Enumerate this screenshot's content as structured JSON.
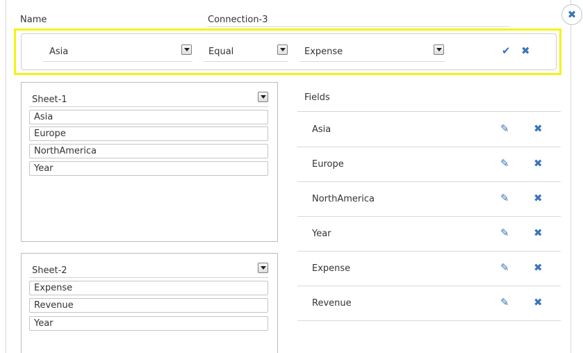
{
  "header": {
    "name_label": "Name",
    "connection_name": "Connection-3"
  },
  "condition": {
    "field": "Asia",
    "operator": "Equal",
    "value": "Expense"
  },
  "sheets": [
    {
      "title": "Sheet-1",
      "items": [
        "Asia",
        "Europe",
        "NorthAmerica",
        "Year"
      ]
    },
    {
      "title": "Sheet-2",
      "items": [
        "Expense",
        "Revenue",
        "Year"
      ]
    }
  ],
  "fields": {
    "title": "Fields",
    "items": [
      "Asia",
      "Europe",
      "NorthAmerica",
      "Year",
      "Expense",
      "Revenue"
    ]
  },
  "icons": {
    "close": "close-icon",
    "confirm": "check-icon",
    "cancel": "x-icon",
    "edit": "pencil-icon",
    "delete": "x-icon",
    "dropdown": "dropdown-arrow-icon"
  },
  "colors": {
    "accent": "#3a75b8",
    "highlight": "#f4f314"
  }
}
